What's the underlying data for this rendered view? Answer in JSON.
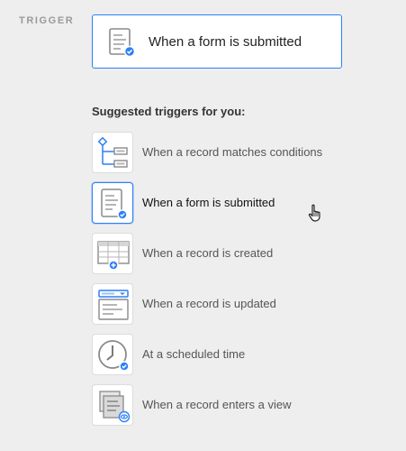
{
  "section_label": "TRIGGER",
  "selected_trigger": {
    "title": "When a form is submitted",
    "icon": "form-icon"
  },
  "suggested_heading": "Suggested triggers for you:",
  "options": [
    {
      "label": "When a record matches conditions",
      "icon": "conditions-icon",
      "active": false
    },
    {
      "label": "When a form is submitted",
      "icon": "form-icon",
      "active": true
    },
    {
      "label": "When a record is created",
      "icon": "record-created-icon",
      "active": false
    },
    {
      "label": "When a record is updated",
      "icon": "record-updated-icon",
      "active": false
    },
    {
      "label": "At a scheduled time",
      "icon": "clock-icon",
      "active": false
    },
    {
      "label": "When a record enters a view",
      "icon": "view-icon",
      "active": false
    }
  ],
  "colors": {
    "accent": "#2d7ff9",
    "background": "#eeeeee",
    "icon_gray": "#8a8a8a"
  }
}
